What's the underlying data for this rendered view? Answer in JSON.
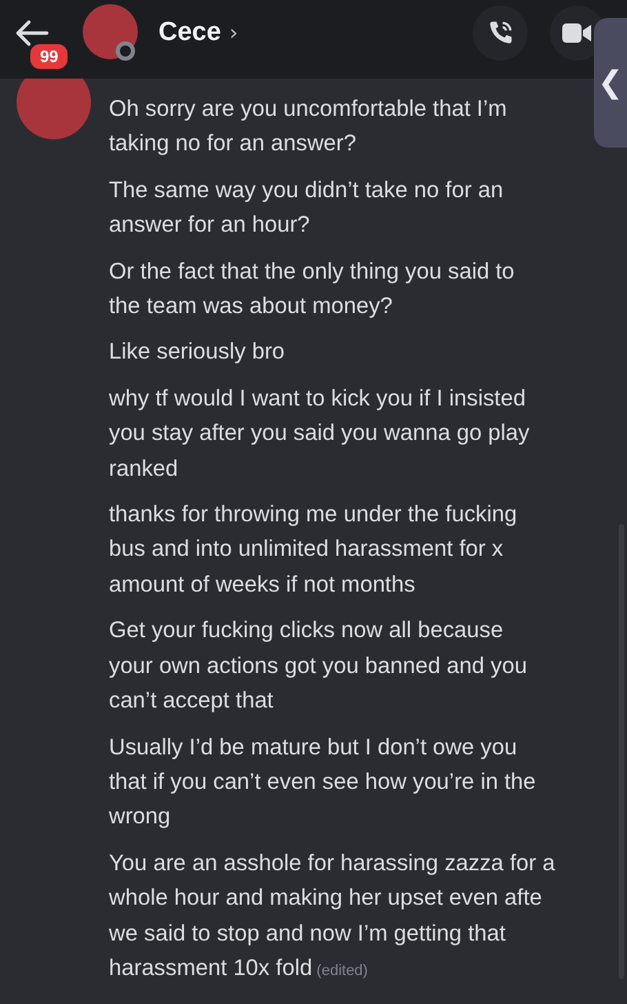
{
  "header": {
    "badge": "99",
    "name": "Cece",
    "chevron": "›",
    "online": false
  },
  "drawer_handle": {
    "glyph": "❮"
  },
  "messages": [
    {
      "lines": [
        "Oh sorry are you uncomfortable that I’m",
        "taking no for an answer?"
      ]
    },
    {
      "lines": [
        "The same way you didn’t take no for an",
        "answer for an hour?"
      ]
    },
    {
      "lines": [
        "Or the fact that the only thing you said to",
        "the team was about money?"
      ]
    },
    {
      "lines": [
        "Like seriously bro"
      ]
    },
    {
      "lines": [
        "why tf would I want to kick you if I insisted",
        "you stay after you said you wanna go play",
        "ranked"
      ]
    },
    {
      "lines": [
        "thanks for throwing me under the fucking",
        "bus and into unlimited harassment for x",
        "amount of weeks if not months"
      ]
    },
    {
      "lines": [
        "Get your fucking clicks now all because",
        "your own actions got you banned and you",
        "can’t accept that"
      ]
    },
    {
      "lines": [
        "Usually I’d be mature but I don’t owe you",
        "that if you can’t even see how you’re in the",
        "wrong"
      ]
    },
    {
      "lines": [
        "You are an asshole for harassing zazza for a",
        "whole hour and making her upset even afte",
        "we said to stop and now I’m getting that",
        "harassment 10x fold"
      ],
      "edited": "(edited)"
    }
  ]
}
